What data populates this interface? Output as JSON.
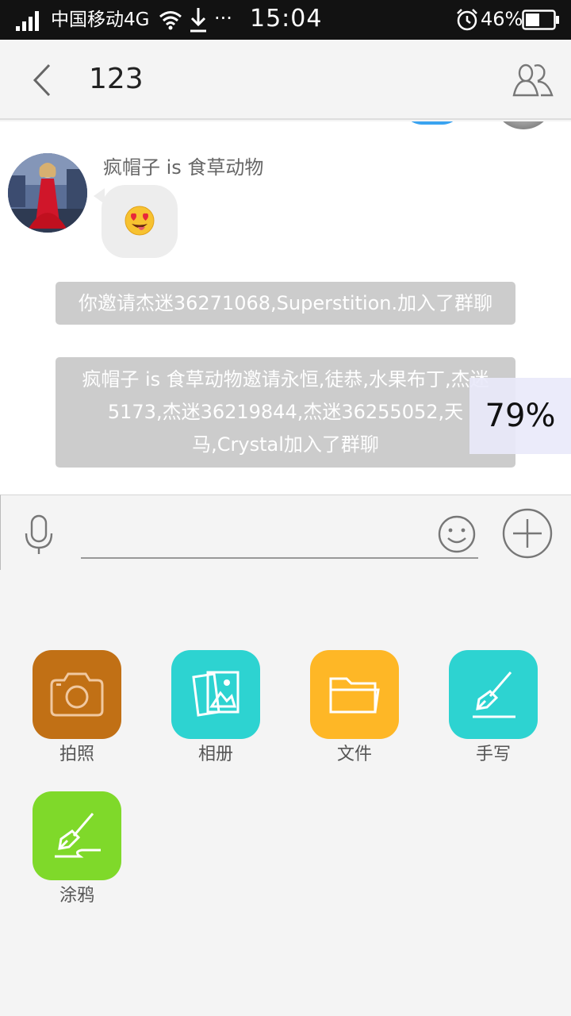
{
  "status_bar": {
    "carrier": "中国移动4G",
    "more": "···",
    "time": "15:04",
    "battery_percent": "46%"
  },
  "header": {
    "title": "123"
  },
  "messages": {
    "sender_name": "疯帽子 is 食草动物",
    "system_1": "你邀请杰迷36271068,Superstition.加入了群聊",
    "system_2": "疯帽子 is 食草动物邀请永恒,徒恭,水果布丁,杰迷5173,杰迷36219844,杰迷36255052,天马,Crystal加入了群聊"
  },
  "overlay": {
    "progress": "79%"
  },
  "input_bar": {
    "value": "",
    "placeholder": ""
  },
  "panel": {
    "items": [
      {
        "label": "拍照",
        "icon": "camera-icon",
        "color": "#c17015"
      },
      {
        "label": "相册",
        "icon": "album-icon",
        "color": "#2dd3d1"
      },
      {
        "label": "文件",
        "icon": "folder-icon",
        "color": "#feb726"
      },
      {
        "label": "手写",
        "icon": "pen-icon",
        "color": "#2dd3d1"
      },
      {
        "label": "涂鸦",
        "icon": "doodle-icon",
        "color": "#7fd92a"
      }
    ]
  }
}
